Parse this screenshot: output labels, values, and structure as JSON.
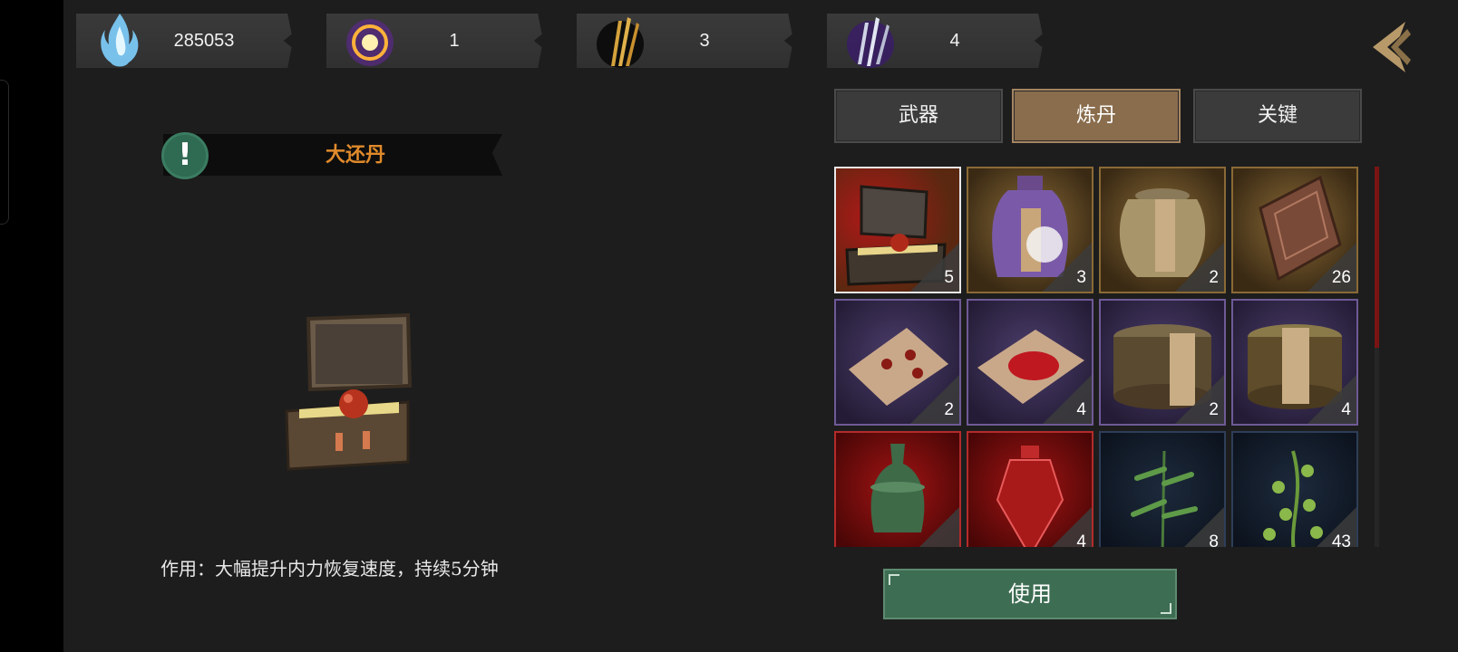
{
  "resources": [
    {
      "name": "blue-flame-crystal-icon",
      "value": "285053"
    },
    {
      "name": "golden-orb-icon",
      "value": "1"
    },
    {
      "name": "golden-blades-icon",
      "value": "3"
    },
    {
      "name": "purple-blades-icon",
      "value": "4"
    }
  ],
  "selected_item": {
    "name": "大还丹",
    "effect": "作用：大幅提升内力恢复速度，持续5分钟"
  },
  "tabs": [
    {
      "label": "武器",
      "active": false
    },
    {
      "label": "炼丹",
      "active": true
    },
    {
      "label": "关键",
      "active": false
    }
  ],
  "items": [
    {
      "icon": "pill-chest-icon",
      "count": "5",
      "rarity": "gold",
      "selected": true
    },
    {
      "icon": "purple-jar-icon",
      "count": "3",
      "rarity": "gold"
    },
    {
      "icon": "clay-jar-icon",
      "count": "2",
      "rarity": "gold"
    },
    {
      "icon": "bronze-tablet-icon",
      "count": "26",
      "rarity": "gold"
    },
    {
      "icon": "pills-on-paper-icon",
      "count": "2",
      "rarity": "purple"
    },
    {
      "icon": "red-powder-paper-icon",
      "count": "4",
      "rarity": "purple"
    },
    {
      "icon": "ornate-box-icon",
      "count": "2",
      "rarity": "purple"
    },
    {
      "icon": "ornate-box-icon",
      "count": "4",
      "rarity": "purple"
    },
    {
      "icon": "jade-vase-icon",
      "count": "",
      "rarity": "red"
    },
    {
      "icon": "red-bottle-icon",
      "count": "4",
      "rarity": "red"
    },
    {
      "icon": "herb-plant-icon",
      "count": "8",
      "rarity": "blue"
    },
    {
      "icon": "vine-herb-icon",
      "count": "43",
      "rarity": "blue"
    }
  ],
  "use_button": "使用",
  "colors": {
    "title_text": "#e08a2b",
    "active_tab": "#8a6d4d",
    "use_button": "#3d6d52",
    "info_badge": "#2f6a52"
  }
}
